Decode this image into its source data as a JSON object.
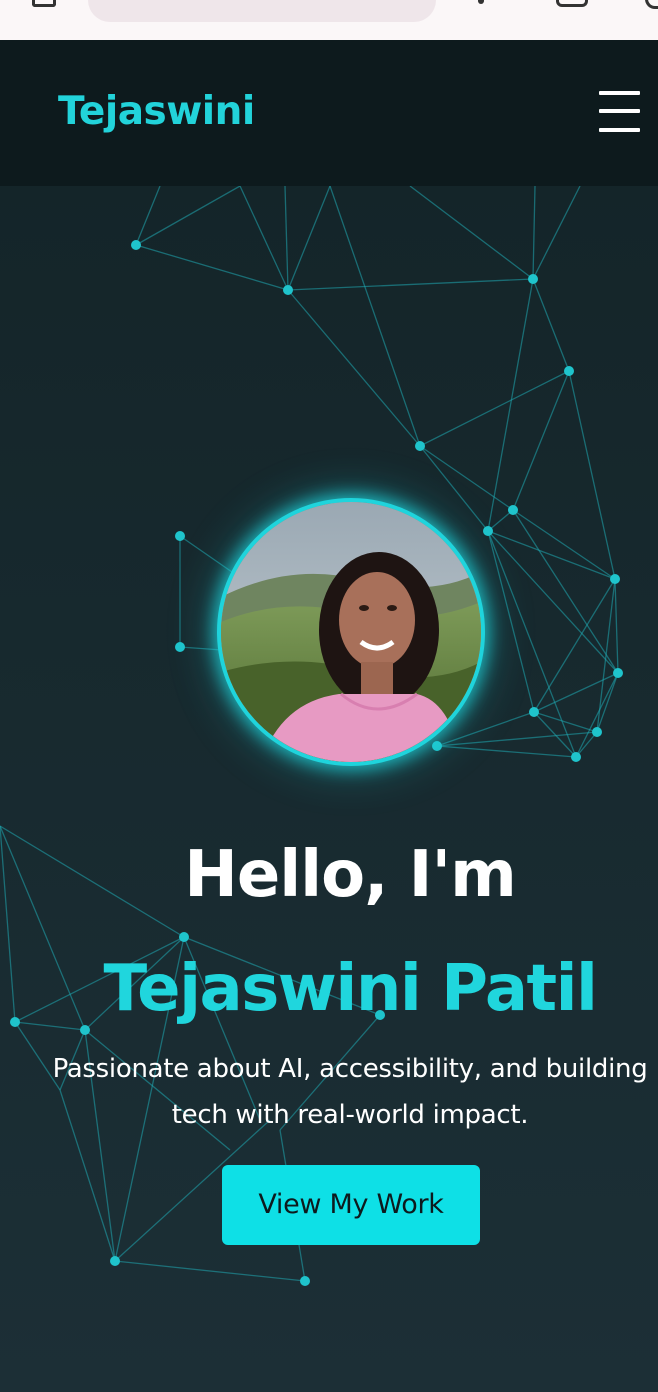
{
  "header": {
    "brand": "Tejaswini",
    "menu_icon": "hamburger-menu-icon"
  },
  "hero": {
    "greeting": "Hello, I'm",
    "name": "Tejaswini Patil",
    "tagline": "Passionate about AI, accessibility, and building tech with real-world impact.",
    "cta_label": "View My Work",
    "avatar_alt": "profile-photo"
  },
  "colors": {
    "accent": "#20d6dd",
    "header_bg": "#0d1a1d",
    "page_bg": "#17292e",
    "cta_bg": "#0ee0e6",
    "text": "#ffffff"
  }
}
